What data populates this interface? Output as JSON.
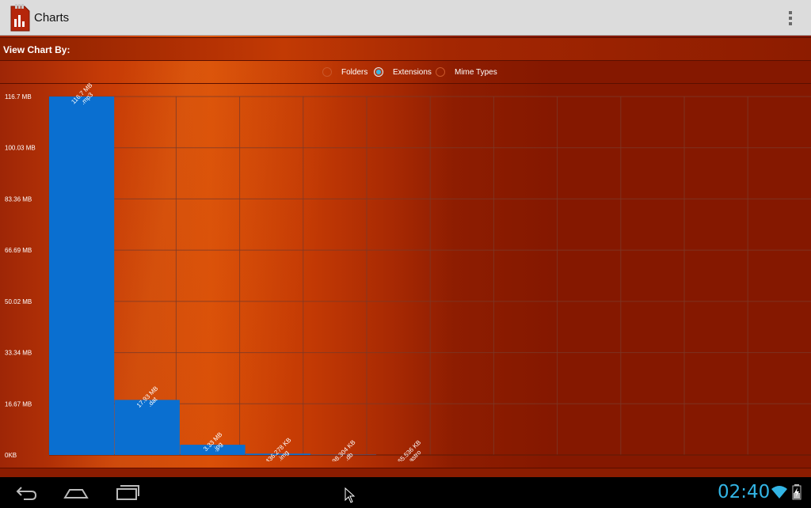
{
  "app": {
    "title": "Charts",
    "icon": "sd-card-chart-icon"
  },
  "view_by": {
    "label": "View Chart By:",
    "options": [
      {
        "label": "Folders",
        "checked": false
      },
      {
        "label": "Extensions",
        "checked": true
      },
      {
        "label": "Mime Types",
        "checked": false
      }
    ]
  },
  "chart_data": {
    "type": "bar",
    "categories": [
      ".mp3",
      ".dat",
      ".jpg",
      ".img",
      ".db",
      ".astro"
    ],
    "values": [
      116.7,
      17.93,
      3.33,
      0.436278,
      0.098304,
      0.065536
    ],
    "value_unit": "MB",
    "data_labels": [
      "116.7 MB",
      "17.93 MB",
      "3.33 MB",
      "436.278 KB",
      "98.304 KB",
      "65.536 KB"
    ],
    "y_tick_labels": [
      "116.7 MB",
      "100.03 MB",
      "83.36 MB",
      "66.69 MB",
      "50.02 MB",
      "33.34 MB",
      "16.67 MB",
      "0KB"
    ],
    "y_ticks": [
      116.7,
      100.03,
      83.36,
      66.69,
      50.02,
      33.34,
      16.67,
      0
    ],
    "ylim": [
      0,
      116.7
    ],
    "grid": true,
    "bar_color": "#0a6fd0"
  },
  "status_bar": {
    "time": "02:40",
    "wifi_icon": "wifi-icon",
    "battery_icon": "battery-charging-icon"
  },
  "nav": {
    "back_icon": "back-icon",
    "home_icon": "home-icon",
    "recents_icon": "recent-apps-icon"
  }
}
